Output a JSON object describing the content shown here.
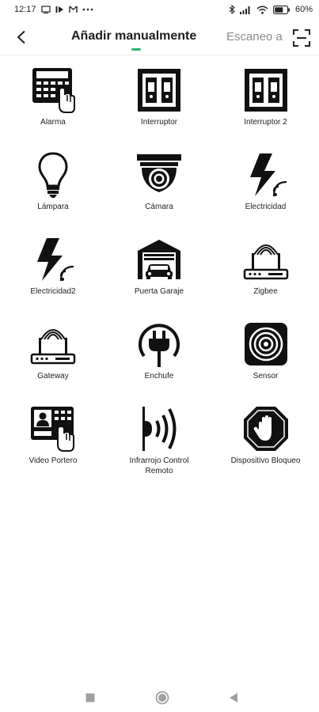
{
  "status_bar": {
    "time": "12:17",
    "battery": "60%"
  },
  "header": {
    "tab_manual": "Añadir manualmente",
    "tab_scan": "Escaneo a",
    "accent_color": "#2bb673"
  },
  "devices": [
    {
      "label": "Alarma",
      "icon": "alarm-keypad-icon"
    },
    {
      "label": "Interruptor",
      "icon": "switch-icon"
    },
    {
      "label": "Interruptor 2",
      "icon": "switch-2-icon"
    },
    {
      "label": "Lámpara",
      "icon": "lamp-icon"
    },
    {
      "label": "Cámara",
      "icon": "camera-icon"
    },
    {
      "label": "Electricidad",
      "icon": "electricity-icon"
    },
    {
      "label": "Electricidad2",
      "icon": "electricity-2-icon"
    },
    {
      "label": "Puerta Garaje",
      "icon": "garage-door-icon"
    },
    {
      "label": "Zigbee",
      "icon": "zigbee-router-icon"
    },
    {
      "label": "Gateway",
      "icon": "gateway-router-icon"
    },
    {
      "label": "Enchufe",
      "icon": "plug-icon"
    },
    {
      "label": "Sensor",
      "icon": "sensor-icon"
    },
    {
      "label": "Video Portero",
      "icon": "video-intercom-icon"
    },
    {
      "label": "Infrarrojo Control Remoto",
      "icon": "infrared-remote-icon"
    },
    {
      "label": "Dispositivo Bloqueo",
      "icon": "block-device-icon"
    }
  ]
}
